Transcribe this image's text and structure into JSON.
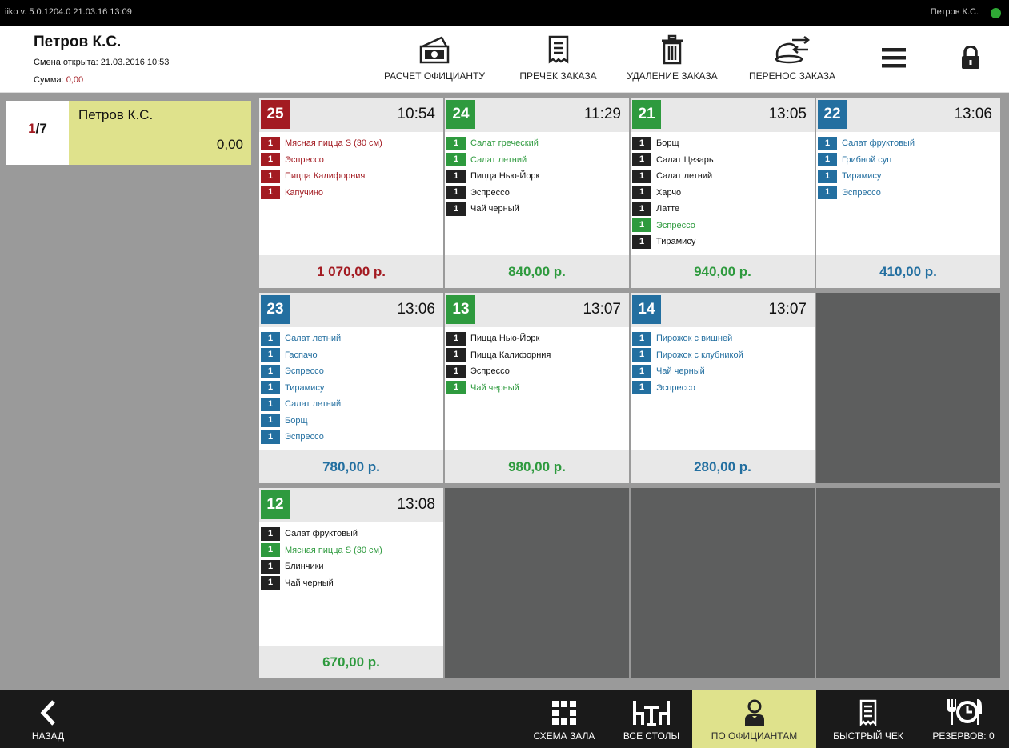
{
  "status_bar": {
    "version": "iiko v. 5.0.1204.0   21.03.16  13:09",
    "user": "Петров К.С."
  },
  "header": {
    "waiter_name": "Петров К.С.",
    "shift_opened": "Смена открыта: 21.03.2016 10:53",
    "sum_label": "Сумма: ",
    "sum_value": "0,00"
  },
  "toolbar": {
    "pay_waiter": "РАСЧЕТ ОФИЦИАНТУ",
    "precheck": "ПРЕЧЕК ЗАКАЗА",
    "delete": "УДАЛЕНИЕ ЗАКАЗА",
    "transfer": "ПЕРЕНОС ЗАКАЗА"
  },
  "left_panel": {
    "page_current": "1",
    "page_total": "/7",
    "waiter_name": "Петров К.С.",
    "waiter_sum": "0,00"
  },
  "orders": [
    {
      "table": "25",
      "time": "10:54",
      "color": "red",
      "total": "1 070,00 р.",
      "items": [
        {
          "q": "1",
          "name": "Мясная пицца S (30 см)",
          "color": "red"
        },
        {
          "q": "1",
          "name": "Эспрессо",
          "color": "red"
        },
        {
          "q": "1",
          "name": "Пицца Калифорния",
          "color": "red"
        },
        {
          "q": "1",
          "name": "Капучино",
          "color": "red"
        }
      ]
    },
    {
      "table": "24",
      "time": "11:29",
      "color": "green",
      "total": "840,00 р.",
      "items": [
        {
          "q": "1",
          "name": "Салат греческий",
          "color": "green"
        },
        {
          "q": "1",
          "name": "Салат летний",
          "color": "green"
        },
        {
          "q": "1",
          "name": "Пицца Нью-Йорк",
          "color": "black"
        },
        {
          "q": "1",
          "name": "Эспрессо",
          "color": "black"
        },
        {
          "q": "1",
          "name": "Чай черный",
          "color": "black"
        }
      ]
    },
    {
      "table": "21",
      "time": "13:05",
      "color": "green",
      "total": "940,00 р.",
      "items": [
        {
          "q": "1",
          "name": "Борщ",
          "color": "black"
        },
        {
          "q": "1",
          "name": "Салат Цезарь",
          "color": "black"
        },
        {
          "q": "1",
          "name": "Салат летний",
          "color": "black"
        },
        {
          "q": "1",
          "name": "Харчо",
          "color": "black"
        },
        {
          "q": "1",
          "name": "Латте",
          "color": "black"
        },
        {
          "q": "1",
          "name": "Эспрессо",
          "color": "green"
        },
        {
          "q": "1",
          "name": "Тирамису",
          "color": "black"
        }
      ]
    },
    {
      "table": "22",
      "time": "13:06",
      "color": "blue",
      "total": "410,00 р.",
      "items": [
        {
          "q": "1",
          "name": "Салат фруктовый",
          "color": "blue"
        },
        {
          "q": "1",
          "name": "Грибной суп",
          "color": "blue"
        },
        {
          "q": "1",
          "name": "Тирамису",
          "color": "blue"
        },
        {
          "q": "1",
          "name": "Эспрессо",
          "color": "blue"
        }
      ]
    },
    {
      "table": "23",
      "time": "13:06",
      "color": "blue",
      "total": "780,00 р.",
      "items": [
        {
          "q": "1",
          "name": "Салат летний",
          "color": "blue"
        },
        {
          "q": "1",
          "name": "Гаспачо",
          "color": "blue"
        },
        {
          "q": "1",
          "name": "Эспрессо",
          "color": "blue"
        },
        {
          "q": "1",
          "name": "Тирамису",
          "color": "blue"
        },
        {
          "q": "1",
          "name": "Салат летний",
          "color": "blue"
        },
        {
          "q": "1",
          "name": "Борщ",
          "color": "blue"
        },
        {
          "q": "1",
          "name": "Эспрессо",
          "color": "blue"
        }
      ]
    },
    {
      "table": "13",
      "time": "13:07",
      "color": "green",
      "total": "980,00 р.",
      "items": [
        {
          "q": "1",
          "name": "Пицца Нью-Йорк",
          "color": "black"
        },
        {
          "q": "1",
          "name": "Пицца Калифорния",
          "color": "black"
        },
        {
          "q": "1",
          "name": "Эспрессо",
          "color": "black"
        },
        {
          "q": "1",
          "name": "Чай черный",
          "color": "green"
        }
      ]
    },
    {
      "table": "14",
      "time": "13:07",
      "color": "blue",
      "total": "280,00 р.",
      "items": [
        {
          "q": "1",
          "name": "Пирожок с вишней",
          "color": "blue"
        },
        {
          "q": "1",
          "name": "Пирожок с клубникой",
          "color": "blue"
        },
        {
          "q": "1",
          "name": "Чай черный",
          "color": "blue"
        },
        {
          "q": "1",
          "name": "Эспрессо",
          "color": "blue"
        }
      ]
    },
    {
      "table": "12",
      "time": "13:08",
      "color": "green",
      "total": "670,00 р.",
      "items": [
        {
          "q": "1",
          "name": "Салат фруктовый",
          "color": "black"
        },
        {
          "q": "1",
          "name": "Мясная пицца S (30 см)",
          "color": "green"
        },
        {
          "q": "1",
          "name": "Блинчики",
          "color": "black"
        },
        {
          "q": "1",
          "name": "Чай черный",
          "color": "black"
        }
      ]
    }
  ],
  "bottom": {
    "back": "НАЗАД",
    "hall_scheme": "СХЕМА ЗАЛА",
    "all_tables": "ВСЕ СТОЛЫ",
    "by_waiters": "ПО ОФИЦИАНТАМ",
    "quick_check": "БЫСТРЫЙ ЧЕК",
    "reservations": "РЕЗЕРВОВ: 0"
  },
  "colors": {
    "red": "#a31b22",
    "green": "#2e9a3e",
    "blue": "#236fa0",
    "highlight": "#dfe28c"
  },
  "icons": [
    "money-icon",
    "receipt-icon",
    "trash-icon",
    "transfer-plate-icon",
    "menu-icon",
    "lock-icon",
    "chevron-left-icon",
    "grid-icon",
    "tables-icon",
    "waiter-icon",
    "receipt-icon",
    "reservation-icon"
  ]
}
